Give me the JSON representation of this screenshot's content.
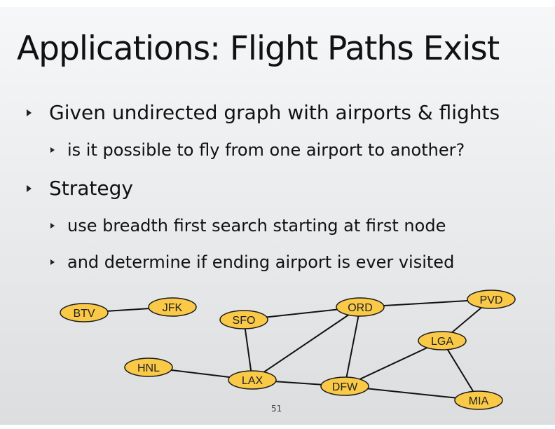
{
  "slide": {
    "title": "Applications: Flight Paths Exist",
    "bullets": [
      {
        "text": "Given undirected graph with airports & flights"
      },
      {
        "text": "is it possible to fly from one airport to another?"
      },
      {
        "text": "Strategy"
      },
      {
        "text": "use breadth first search starting at first node"
      },
      {
        "text": "and determine if ending airport is ever visited"
      }
    ],
    "page_number": "51"
  },
  "graph": {
    "node_fill": "#f9c947",
    "node_stroke": "#1a1a1a",
    "edge_color": "#111111",
    "nodes": [
      "BTV",
      "JFK",
      "SFO",
      "ORD",
      "PVD",
      "LGA",
      "HNL",
      "LAX",
      "DFW",
      "MIA"
    ],
    "edges": [
      [
        "BTV",
        "JFK"
      ],
      [
        "SFO",
        "ORD"
      ],
      [
        "SFO",
        "LAX"
      ],
      [
        "ORD",
        "PVD"
      ],
      [
        "ORD",
        "LAX"
      ],
      [
        "ORD",
        "DFW"
      ],
      [
        "PVD",
        "LGA"
      ],
      [
        "LGA",
        "DFW"
      ],
      [
        "LGA",
        "MIA"
      ],
      [
        "HNL",
        "LAX"
      ],
      [
        "LAX",
        "DFW"
      ],
      [
        "DFW",
        "MIA"
      ]
    ]
  }
}
